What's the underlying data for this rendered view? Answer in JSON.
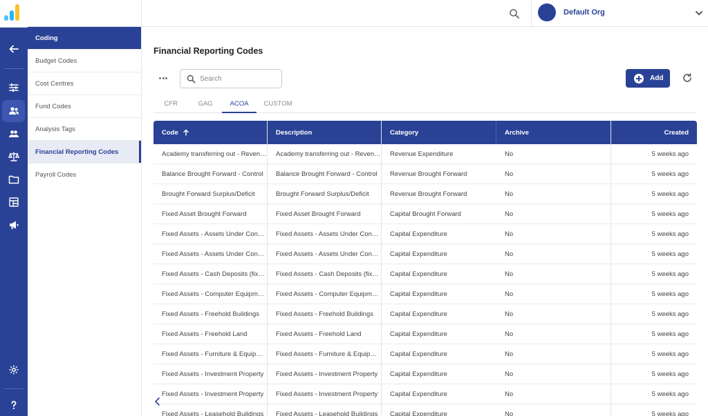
{
  "brand": {
    "logo_colors": [
      "#4fc3f7",
      "#29b6f6",
      "#fbc02d"
    ]
  },
  "topbar": {
    "org_name": "Default Org"
  },
  "subnav": {
    "header": "Coding",
    "items": [
      "Budget Codes",
      "Cost Centres",
      "Fund Codes",
      "Analysis Tags",
      "Financial Reporting Codes",
      "Payroll Codes"
    ],
    "active": "Financial Reporting Codes"
  },
  "page": {
    "title": "Financial Reporting Codes"
  },
  "search": {
    "placeholder": "Search"
  },
  "toolbar": {
    "add_label": "Add"
  },
  "tabs": [
    "CFR",
    "GAG",
    "ACOA",
    "CUSTOM"
  ],
  "active_tab": "ACOA",
  "table": {
    "columns": {
      "code": "Code",
      "description": "Description",
      "category": "Category",
      "archive": "Archive",
      "created": "Created"
    },
    "rows": [
      {
        "code": "Academy transferring out - Revenue",
        "description": "Academy transferring out - Revenue",
        "category": "Revenue Expenditure",
        "archive": "No",
        "created": "5 weeks ago"
      },
      {
        "code": "Balance Brought Forward - Control",
        "description": "Balance Brought Forward - Control",
        "category": "Revenue Brought Forward",
        "archive": "No",
        "created": "5 weeks ago"
      },
      {
        "code": "Brought Forward Surplus/Deficit",
        "description": "Brought Forward Surplus/Deficit",
        "category": "Revenue Brought Forward",
        "archive": "No",
        "created": "5 weeks ago"
      },
      {
        "code": "Fixed Asset Brought Forward",
        "description": "Fixed Asset Brought Forward",
        "category": "Capital Brought Forward",
        "archive": "No",
        "created": "5 weeks ago"
      },
      {
        "code": "Fixed Assets - Assets Under Construction",
        "description": "Fixed Assets - Assets Under Construction",
        "category": "Capital Expenditure",
        "archive": "No",
        "created": "5 weeks ago"
      },
      {
        "code": "Fixed Assets - Assets Under Construction",
        "description": "Fixed Assets - Assets Under Construction",
        "category": "Capital Expenditure",
        "archive": "No",
        "created": "5 weeks ago"
      },
      {
        "code": "Fixed Assets - Cash Deposits (fixed)",
        "description": "Fixed Assets - Cash Deposits (fixed)",
        "category": "Capital Expenditure",
        "archive": "No",
        "created": "5 weeks ago"
      },
      {
        "code": "Fixed Assets - Computer Equipment",
        "description": "Fixed Assets - Computer Equipment",
        "category": "Capital Expenditure",
        "archive": "No",
        "created": "5 weeks ago"
      },
      {
        "code": "Fixed Assets - Freehold Buildings",
        "description": "Fixed Assets - Freehold Buildings",
        "category": "Capital Expenditure",
        "archive": "No",
        "created": "5 weeks ago"
      },
      {
        "code": "Fixed Assets - Freehold Land",
        "description": "Fixed Assets - Freehold Land",
        "category": "Capital Expenditure",
        "archive": "No",
        "created": "5 weeks ago"
      },
      {
        "code": "Fixed Assets - Furniture & Equipment",
        "description": "Fixed Assets - Furniture & Equipment",
        "category": "Capital Expenditure",
        "archive": "No",
        "created": "5 weeks ago"
      },
      {
        "code": "Fixed Assets - Investment Property",
        "description": "Fixed Assets - Investment Property",
        "category": "Capital Expenditure",
        "archive": "No",
        "created": "5 weeks ago"
      },
      {
        "code": "Fixed Assets - Investment Property",
        "description": "Fixed Assets - Investment Property",
        "category": "Capital Expenditure",
        "archive": "No",
        "created": "5 weeks ago"
      },
      {
        "code": "Fixed Assets - Leasehold Buildings",
        "description": "Fixed Assets - Leasehold Buildings",
        "category": "Capital Expenditure",
        "archive": "No",
        "created": "5 weeks ago"
      }
    ]
  },
  "rail_icons": [
    "back-arrow-icon",
    "sliders-icon",
    "users-icon",
    "people-icon",
    "scales-icon",
    "folder-icon",
    "ledger-icon",
    "megaphone-icon",
    "settings-icon",
    "help-icon"
  ],
  "colors": {
    "primary": "#2a4295",
    "primary_light": "#3d57b0"
  }
}
